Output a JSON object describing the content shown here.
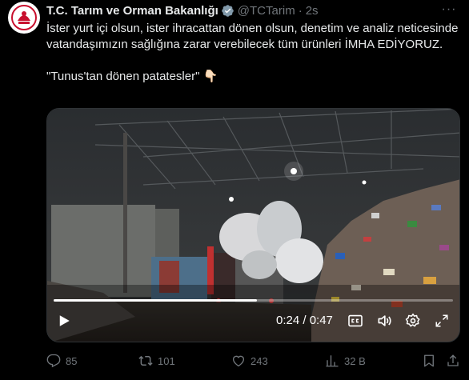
{
  "tweet": {
    "author_name": "T.C. Tarım ve Orman Bakanlığı",
    "handle": "@TCTarim",
    "separator": "·",
    "time": "2s",
    "text_line1": "İster yurt içi olsun, ister ihracattan dönen olsun, denetim ve analiz neticesinde vatandaşımızın sağlığına zarar verebilecek tüm ürünleri İMHA EDİYORUZ.",
    "text_line2": "\"Tunus'tan dönen patatesler\" 👇🏻"
  },
  "video": {
    "current_time": "0:24",
    "duration": "0:47",
    "time_display": "0:24 / 0:47",
    "progress": 0.51
  },
  "actions": {
    "replies": "85",
    "reposts": "101",
    "likes": "243",
    "views": "32 B"
  },
  "colors": {
    "background": "#000000",
    "text": "#e7e9ea",
    "muted": "#71767b",
    "verified_gray": "#829aab",
    "logo_red": "#c8102e"
  },
  "icons": [
    "avatar-logo",
    "verified-badge-icon",
    "more-options-icon",
    "play-icon",
    "captions-icon",
    "volume-icon",
    "settings-gear-icon",
    "fullscreen-icon",
    "reply-icon",
    "repost-icon",
    "like-icon",
    "views-icon",
    "bookmark-icon",
    "share-icon"
  ]
}
